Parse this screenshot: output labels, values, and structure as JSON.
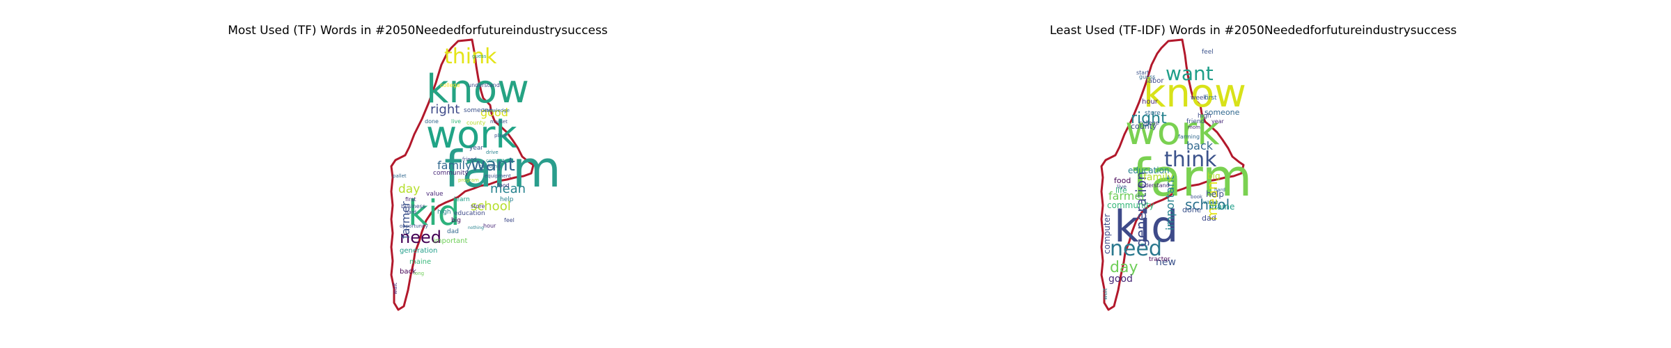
{
  "chart_data": [
    {
      "type": "wordcloud",
      "title": "Most Used (TF) Words in #2050Neededforfutureindustrysuccess",
      "mask_shape": "state of Maine",
      "outline_color": "#b2182b",
      "colormap": "viridis",
      "words": [
        {
          "text": "farm",
          "weight": 100,
          "color": "#2a9d8c"
        },
        {
          "text": "know",
          "weight": 90,
          "color": "#25a383"
        },
        {
          "text": "work",
          "weight": 82,
          "color": "#20a486"
        },
        {
          "text": "kid",
          "weight": 74,
          "color": "#2db27d"
        },
        {
          "text": "think",
          "weight": 50,
          "color": "#e3e418"
        },
        {
          "text": "want",
          "weight": 40,
          "color": "#31688e"
        },
        {
          "text": "need",
          "weight": 38,
          "color": "#440154"
        },
        {
          "text": "right",
          "weight": 30,
          "color": "#3e4a89"
        },
        {
          "text": "family",
          "weight": 30,
          "color": "#31688e"
        },
        {
          "text": "school",
          "weight": 28,
          "color": "#b5de2b"
        },
        {
          "text": "mean",
          "weight": 26,
          "color": "#26828e"
        },
        {
          "text": "day",
          "weight": 26,
          "color": "#b5de2b"
        },
        {
          "text": "farmer",
          "weight": 24,
          "color": "#3b528b"
        },
        {
          "text": "good",
          "weight": 22,
          "color": "#d8e219"
        },
        {
          "text": "community",
          "weight": 14,
          "color": "#482878"
        },
        {
          "text": "important",
          "weight": 14,
          "color": "#6ece58"
        },
        {
          "text": "generation",
          "weight": 14,
          "color": "#1f9e89"
        },
        {
          "text": "education",
          "weight": 13,
          "color": "#3e4a89"
        },
        {
          "text": "someone",
          "weight": 12,
          "color": "#3b528b"
        },
        {
          "text": "value",
          "weight": 12,
          "color": "#482878"
        },
        {
          "text": "high",
          "weight": 11,
          "color": "#26828e"
        },
        {
          "text": "maine",
          "weight": 11,
          "color": "#35b779"
        },
        {
          "text": "back",
          "weight": 11,
          "color": "#440154"
        },
        {
          "text": "year",
          "weight": 11,
          "color": "#3b528b"
        },
        {
          "text": "learn",
          "weight": 10,
          "color": "#1f9e89"
        },
        {
          "text": "store",
          "weight": 10,
          "color": "#46327e"
        },
        {
          "text": "done",
          "weight": 10,
          "color": "#31688e"
        },
        {
          "text": "live",
          "weight": 10,
          "color": "#35b779"
        },
        {
          "text": "first",
          "weight": 10,
          "color": "#482878"
        },
        {
          "text": "business",
          "weight": 10,
          "color": "#3e4a89"
        },
        {
          "text": "big",
          "weight": 10,
          "color": "#440154"
        },
        {
          "text": "dad",
          "weight": 10,
          "color": "#31688e"
        },
        {
          "text": "help",
          "weight": 10,
          "color": "#26828e"
        },
        {
          "text": "county",
          "weight": 10,
          "color": "#b5de2b"
        },
        {
          "text": "college",
          "weight": 9,
          "color": "#fde725"
        },
        {
          "text": "understand",
          "weight": 9,
          "color": "#3e4a89"
        },
        {
          "text": "knowledge",
          "weight": 9,
          "color": "#31688e"
        },
        {
          "text": "market",
          "weight": 9,
          "color": "#3b528b"
        },
        {
          "text": "computer",
          "weight": 9,
          "color": "#1f9e89"
        },
        {
          "text": "equipment",
          "weight": 9,
          "color": "#3b528b"
        },
        {
          "text": "food",
          "weight": 9,
          "color": "#46327e"
        },
        {
          "text": "friend",
          "weight": 9,
          "color": "#3e4a89"
        },
        {
          "text": "california",
          "weight": 9,
          "color": "#31688e"
        },
        {
          "text": "program",
          "weight": 9,
          "color": "#b5de2b"
        },
        {
          "text": "opportunity",
          "weight": 9,
          "color": "#3b528b"
        },
        {
          "text": "hour",
          "weight": 9,
          "color": "#482878"
        },
        {
          "text": "nothing",
          "weight": 9,
          "color": "#26828e"
        },
        {
          "text": "feel",
          "weight": 9,
          "color": "#3e4a89"
        },
        {
          "text": "pallet",
          "weight": 9,
          "color": "#31688e"
        },
        {
          "text": "drive",
          "weight": 9,
          "color": "#26828e"
        },
        {
          "text": "place",
          "weight": 9,
          "color": "#3b528b"
        },
        {
          "text": "long",
          "weight": 9,
          "color": "#6ece58"
        },
        {
          "text": "hard",
          "weight": 9,
          "color": "#3e4a89"
        },
        {
          "text": "guess",
          "weight": 9,
          "color": "#1f9e89"
        },
        {
          "text": "wait",
          "weight": 9,
          "color": "#482878"
        }
      ]
    },
    {
      "type": "wordcloud",
      "title": "Least Used (TF-IDF) Words in #2050Neededforfutureindustrysuccess",
      "mask_shape": "state of Maine",
      "outline_color": "#b2182b",
      "colormap": "viridis",
      "words": [
        {
          "text": "farm",
          "weight": 100,
          "color": "#7ad151"
        },
        {
          "text": "work",
          "weight": 85,
          "color": "#7ad151"
        },
        {
          "text": "know",
          "weight": 82,
          "color": "#d8e219"
        },
        {
          "text": "kid",
          "weight": 80,
          "color": "#3e4a89"
        },
        {
          "text": "think",
          "weight": 48,
          "color": "#3b528b"
        },
        {
          "text": "want",
          "weight": 42,
          "color": "#1f9e89"
        },
        {
          "text": "need",
          "weight": 40,
          "color": "#2a788e"
        },
        {
          "text": "right",
          "weight": 34,
          "color": "#26828e"
        },
        {
          "text": "school",
          "weight": 30,
          "color": "#2c728e"
        },
        {
          "text": "day",
          "weight": 28,
          "color": "#6ece58"
        },
        {
          "text": "generation",
          "weight": 26,
          "color": "#3e4a89"
        },
        {
          "text": "important",
          "weight": 24,
          "color": "#26828e"
        },
        {
          "text": "mean",
          "weight": 24,
          "color": "#e3e418"
        },
        {
          "text": "back",
          "weight": 22,
          "color": "#31688e"
        },
        {
          "text": "farmer",
          "weight": 20,
          "color": "#6ece58"
        },
        {
          "text": "family",
          "weight": 20,
          "color": "#b5de2b"
        },
        {
          "text": "good",
          "weight": 18,
          "color": "#482878"
        },
        {
          "text": "computer",
          "weight": 14,
          "color": "#3e4a89"
        },
        {
          "text": "education",
          "weight": 14,
          "color": "#26828e"
        },
        {
          "text": "community",
          "weight": 14,
          "color": "#35b779"
        },
        {
          "text": "new",
          "weight": 14,
          "color": "#3b528b"
        },
        {
          "text": "help",
          "weight": 13,
          "color": "#3b528b"
        },
        {
          "text": "maine",
          "weight": 13,
          "color": "#1f9e89"
        },
        {
          "text": "big",
          "weight": 12,
          "color": "#b5de2b"
        },
        {
          "text": "someone",
          "weight": 12,
          "color": "#31688e"
        },
        {
          "text": "county",
          "weight": 11,
          "color": "#3e4a89"
        },
        {
          "text": "food",
          "weight": 11,
          "color": "#440154"
        },
        {
          "text": "life",
          "weight": 11,
          "color": "#35b779"
        },
        {
          "text": "done",
          "weight": 11,
          "color": "#3b528b"
        },
        {
          "text": "dad",
          "weight": 10,
          "color": "#3e4a89"
        },
        {
          "text": "hour",
          "weight": 10,
          "color": "#482878"
        },
        {
          "text": "store",
          "weight": 10,
          "color": "#31688e"
        },
        {
          "text": "high",
          "weight": 10,
          "color": "#3e4a89"
        },
        {
          "text": "friend",
          "weight": 10,
          "color": "#3b528b"
        },
        {
          "text": "farming",
          "weight": 10,
          "color": "#31688e"
        },
        {
          "text": "value",
          "weight": 10,
          "color": "#26828e"
        },
        {
          "text": "understand",
          "weight": 10,
          "color": "#482878"
        },
        {
          "text": "live",
          "weight": 10,
          "color": "#3b528b"
        },
        {
          "text": "tractor",
          "weight": 10,
          "color": "#440154"
        },
        {
          "text": "labor",
          "weight": 10,
          "color": "#3e4a89"
        },
        {
          "text": "guess",
          "weight": 9,
          "color": "#31688e"
        },
        {
          "text": "feel",
          "weight": 9,
          "color": "#3b528b"
        },
        {
          "text": "week",
          "weight": 9,
          "color": "#3e4a89"
        },
        {
          "text": "first",
          "weight": 9,
          "color": "#31688e"
        },
        {
          "text": "start",
          "weight": 9,
          "color": "#3b528b"
        },
        {
          "text": "college",
          "weight": 9,
          "color": "#3e4a89"
        },
        {
          "text": "mom",
          "weight": 9,
          "color": "#482878"
        },
        {
          "text": "book",
          "weight": 9,
          "color": "#3b528b"
        },
        {
          "text": "hard",
          "weight": 9,
          "color": "#31688e"
        },
        {
          "text": "year",
          "weight": 9,
          "color": "#482878"
        },
        {
          "text": "wait",
          "weight": 9,
          "color": "#26828e"
        }
      ]
    }
  ]
}
